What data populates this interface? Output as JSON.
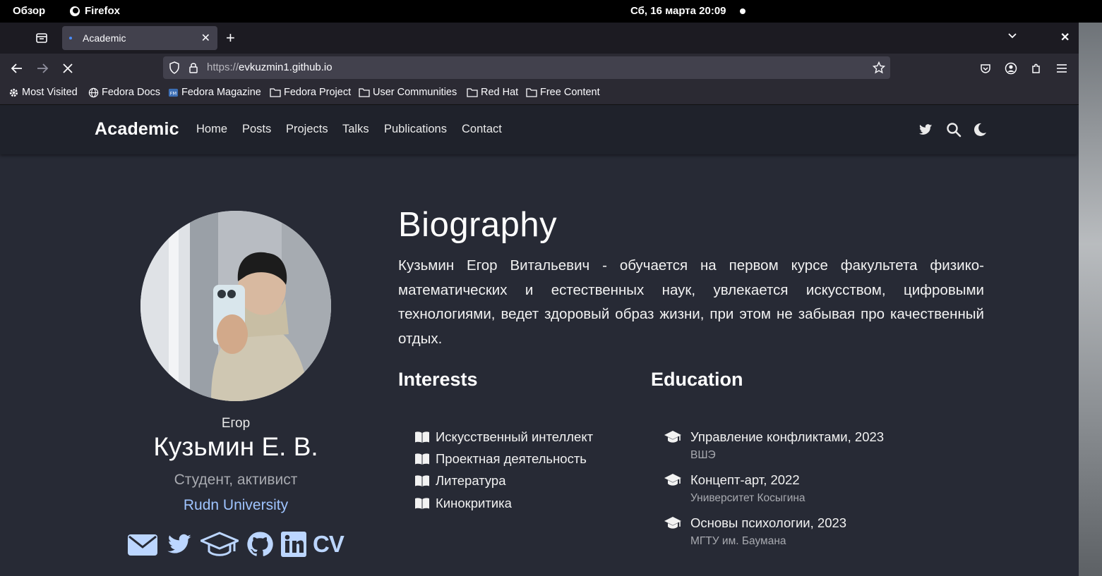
{
  "system_bar": {
    "overview": "Обзор",
    "app_name": "Firefox",
    "datetime": "Сб, 16 марта  20:09"
  },
  "browser": {
    "tab_title": "Academic",
    "url_protocol": "https://",
    "url_host": "evkuzmin1.github.io",
    "bookmarks": [
      {
        "label": "Most Visited",
        "icon": "gear-icon"
      },
      {
        "label": "Fedora Docs",
        "icon": "globe-icon"
      },
      {
        "label": "Fedora Magazine",
        "icon": "fm-icon"
      },
      {
        "label": "Fedora Project",
        "icon": "folder-icon"
      },
      {
        "label": "User Communities",
        "icon": "folder-icon"
      },
      {
        "label": "Red Hat",
        "icon": "folder-icon"
      },
      {
        "label": "Free Content",
        "icon": "folder-icon"
      }
    ]
  },
  "site": {
    "brand": "Academic",
    "menu": [
      "Home",
      "Posts",
      "Projects",
      "Talks",
      "Publications",
      "Contact"
    ],
    "header_icons": [
      "twitter-icon",
      "search-icon",
      "moon-icon"
    ]
  },
  "profile": {
    "first_name": "Егор",
    "full_name": "Кузьмин Е. В.",
    "role": "Студент, активист",
    "organization": "Rudn University",
    "social_icons": [
      "envelope-icon",
      "twitter-icon",
      "graduation-cap-icon",
      "github-icon",
      "linkedin-icon"
    ],
    "cv_label": "CV"
  },
  "biography": {
    "title": "Biography",
    "text": "Кузьмин Егор Витальевич - обучается на первом курсе факультета физико-математических и естественных наук, увлекается искусством, цифровыми технологиями, ведет здоровый образ жизни, при этом не забывая про качественный отдых."
  },
  "interests": {
    "title": "Interests",
    "items": [
      "Искусственный интеллект",
      "Проектная деятельность",
      "Литература",
      "Кинокритика"
    ]
  },
  "education": {
    "title": "Education",
    "items": [
      {
        "course": "Управление конфликтами, 2023",
        "institution": "ВШЭ"
      },
      {
        "course": "Концепт-арт, 2022",
        "institution": "Университет Косыгина"
      },
      {
        "course": "Основы психологии, 2023",
        "institution": "МГТУ им. Баумана"
      }
    ]
  },
  "colors": {
    "page_bg": "#272a35",
    "nav_bg": "#1f222b",
    "link": "#9fc4ff",
    "social": "#bcd6ff"
  }
}
